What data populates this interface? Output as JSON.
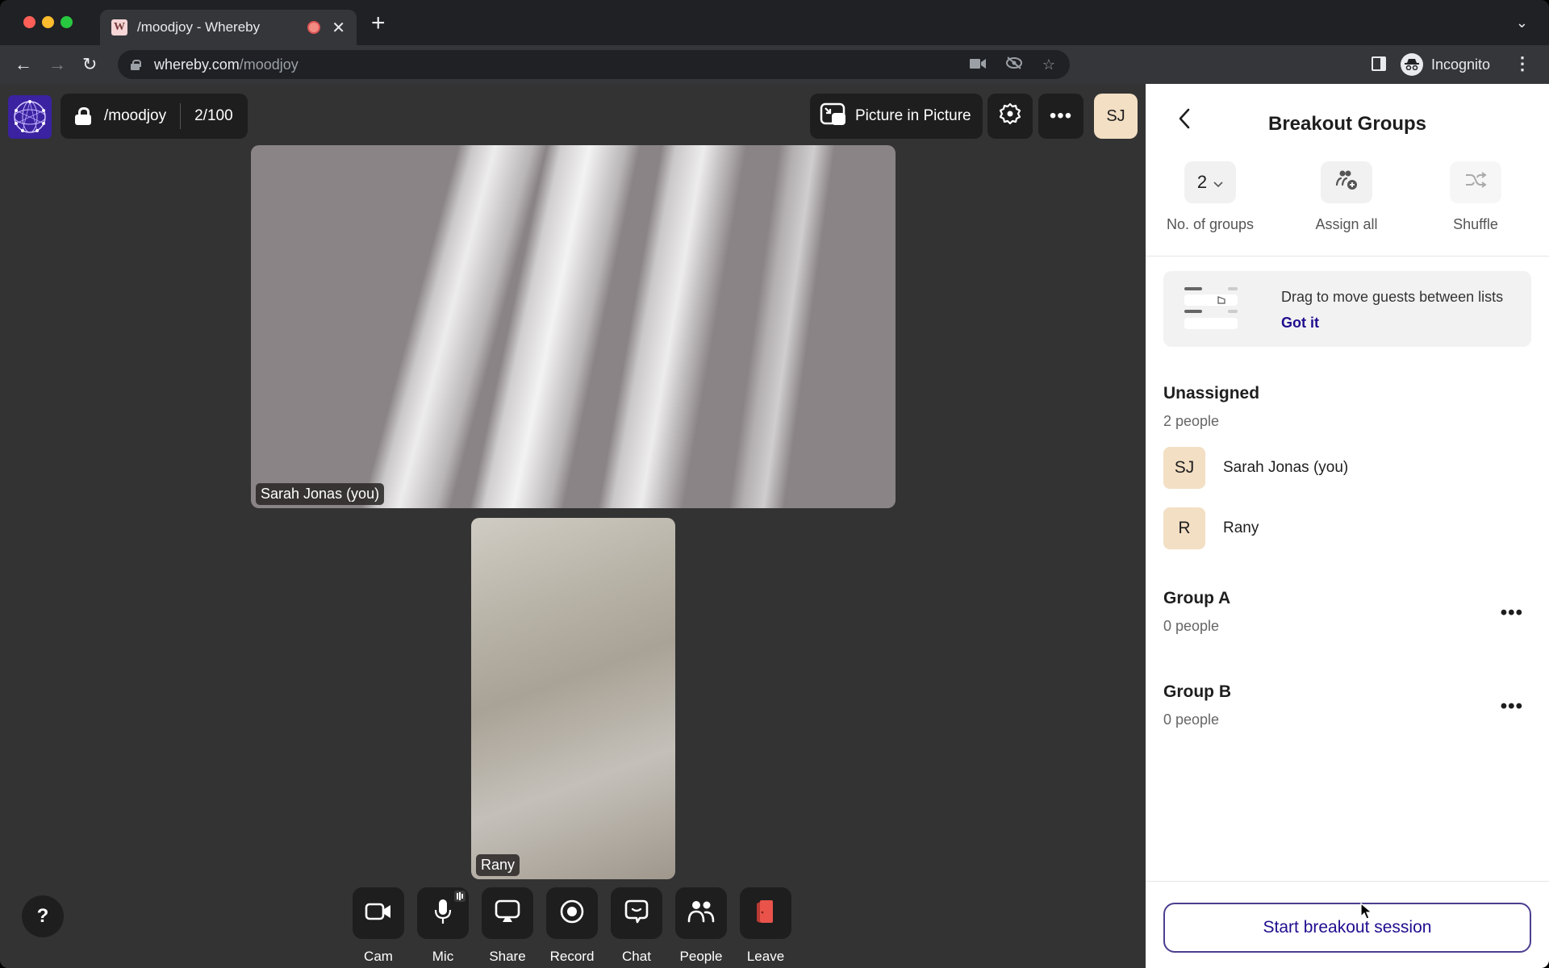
{
  "browser": {
    "tab": {
      "favicon_letter": "W",
      "title": "/moodjoy - Whereby",
      "recording_indicator": "recording-dot-icon",
      "close_icon": "close-icon"
    },
    "new_tab_icon": "plus-icon",
    "tab_list_icon": "chevron-down-icon",
    "url_host": "whereby.com",
    "url_path": "/moodjoy",
    "address_icons": [
      "camera-icon",
      "eye-off-icon",
      "star-icon"
    ],
    "profile_label": "Incognito"
  },
  "app": {
    "room_name": "/moodjoy",
    "participants_count": "2/100",
    "pip_label": "Picture in Picture",
    "user_initials": "SJ",
    "accent_color": "#f3dfc4",
    "tiles": [
      {
        "label": "Sarah Jonas (you)"
      },
      {
        "label": "Rany"
      }
    ],
    "help_label": "?",
    "controls": [
      {
        "label": "Cam",
        "icon": "camera-icon"
      },
      {
        "label": "Mic",
        "icon": "microphone-icon"
      },
      {
        "label": "Share",
        "icon": "screen-share-icon"
      },
      {
        "label": "Record",
        "icon": "record-icon"
      },
      {
        "label": "Chat",
        "icon": "chat-icon"
      },
      {
        "label": "People",
        "icon": "people-icon"
      },
      {
        "label": "Leave",
        "icon": "leave-door-icon"
      }
    ]
  },
  "panel": {
    "title": "Breakout Groups",
    "actions": {
      "groups_value": "2",
      "groups_label": "No. of groups",
      "assign_label": "Assign all",
      "shuffle_label": "Shuffle"
    },
    "tip": {
      "text": "Drag to move guests between lists",
      "link": "Got it"
    },
    "unassigned": {
      "title": "Unassigned",
      "count": "2 people",
      "people": [
        {
          "initials": "SJ",
          "name": "Sarah Jonas (you)"
        },
        {
          "initials": "R",
          "name": "Rany"
        }
      ]
    },
    "groups": [
      {
        "title": "Group A",
        "count": "0 people"
      },
      {
        "title": "Group B",
        "count": "0 people"
      }
    ],
    "start_label": "Start breakout session",
    "primary_color": "#1f0d8f"
  }
}
